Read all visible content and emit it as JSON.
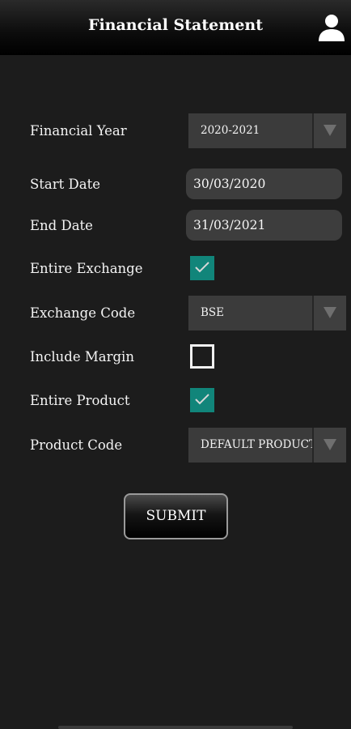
{
  "header": {
    "title": "Financial Statement",
    "user_icon": "user-icon"
  },
  "form": {
    "financial_year": {
      "label": "Financial Year",
      "value": "2020-2021"
    },
    "start_date": {
      "label": "Start Date",
      "value": "30/03/2020"
    },
    "end_date": {
      "label": "End Date",
      "value": "31/03/2021"
    },
    "entire_exchange": {
      "label": "Entire Exchange",
      "checked": true
    },
    "exchange_code": {
      "label": "Exchange Code",
      "value": "BSE"
    },
    "include_margin": {
      "label": "Include Margin",
      "checked": false
    },
    "entire_product": {
      "label": "Entire Product",
      "checked": true
    },
    "product_code": {
      "label": "Product Code",
      "value": "DEFAULT PRODUCT"
    }
  },
  "submit_label": "SUBMIT",
  "colors": {
    "checkbox_checked": "#11857a",
    "background": "#1c1c1c",
    "field": "#3d3d3d"
  }
}
